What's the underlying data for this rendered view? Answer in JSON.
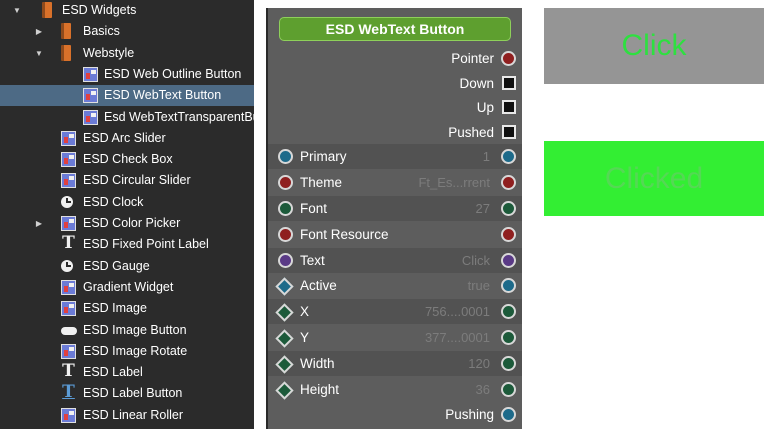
{
  "tree": {
    "items": [
      {
        "label": "ESD Widgets",
        "icon": "book-icon",
        "arrow": "expanded",
        "indent": 1,
        "selected": false
      },
      {
        "label": "Basics",
        "icon": "book-icon",
        "arrow": "collapsed",
        "indent": 2,
        "selected": false
      },
      {
        "label": "Webstyle",
        "icon": "book-icon",
        "arrow": "expanded",
        "indent": 2,
        "selected": false
      },
      {
        "label": "ESD Web Outline Button",
        "icon": "widget-icon",
        "arrow": "none",
        "indent": 3,
        "selected": false
      },
      {
        "label": "ESD WebText Button",
        "icon": "widget-icon",
        "arrow": "none",
        "indent": 3,
        "selected": true
      },
      {
        "label": "Esd WebTextTransparentBu",
        "icon": "widget-icon",
        "arrow": "none",
        "indent": 3,
        "selected": false
      },
      {
        "label": "ESD Arc Slider",
        "icon": "widget-icon",
        "arrow": "none",
        "indent": 2,
        "selected": false
      },
      {
        "label": "ESD Check Box",
        "icon": "widget-icon",
        "arrow": "none",
        "indent": 2,
        "selected": false
      },
      {
        "label": "ESD Circular Slider",
        "icon": "widget-icon",
        "arrow": "none",
        "indent": 2,
        "selected": false
      },
      {
        "label": "ESD Clock",
        "icon": "clock-icon",
        "arrow": "none",
        "indent": 2,
        "selected": false
      },
      {
        "label": "ESD Color Picker",
        "icon": "widget-icon",
        "arrow": "collapsed",
        "indent": 2,
        "selected": false
      },
      {
        "label": "ESD Fixed Point Label",
        "icon": "text-icon",
        "arrow": "none",
        "indent": 2,
        "selected": false
      },
      {
        "label": "ESD Gauge",
        "icon": "clock-icon",
        "arrow": "none",
        "indent": 2,
        "selected": false
      },
      {
        "label": "Gradient Widget",
        "icon": "widget-icon",
        "arrow": "none",
        "indent": 2,
        "selected": false
      },
      {
        "label": "ESD Image",
        "icon": "widget-icon",
        "arrow": "none",
        "indent": 2,
        "selected": false
      },
      {
        "label": "ESD Image Button",
        "icon": "image-button-icon",
        "arrow": "none",
        "indent": 2,
        "selected": false
      },
      {
        "label": "ESD Image Rotate",
        "icon": "widget-icon",
        "arrow": "none",
        "indent": 2,
        "selected": false
      },
      {
        "label": "ESD Label",
        "icon": "text-icon",
        "arrow": "none",
        "indent": 2,
        "selected": false
      },
      {
        "label": "ESD Label Button",
        "icon": "text-underline-icon",
        "arrow": "none",
        "indent": 2,
        "selected": false
      },
      {
        "label": "ESD Linear Roller",
        "icon": "widget-icon",
        "arrow": "none",
        "indent": 2,
        "selected": false
      }
    ]
  },
  "node": {
    "title": "ESD WebText Button",
    "outputs": [
      {
        "label": "Pointer",
        "port": "red"
      },
      {
        "label": "Down",
        "port": "square"
      },
      {
        "label": "Up",
        "port": "square"
      },
      {
        "label": "Pushed",
        "port": "square"
      }
    ],
    "properties": [
      {
        "label": "Primary",
        "value": "1",
        "in": "cyan",
        "out": "cyan"
      },
      {
        "label": "Theme",
        "value": "Ft_Es...rrent",
        "in": "red",
        "out": "red"
      },
      {
        "label": "Font",
        "value": "27",
        "in": "green",
        "out": "green"
      },
      {
        "label": "Font Resource",
        "value": "",
        "in": "red",
        "out": "red"
      },
      {
        "label": "Text",
        "value": "Click",
        "in": "purple",
        "out": "purple"
      },
      {
        "label": "Active",
        "value": "true",
        "in": "diamond-cyan",
        "out": "cyan"
      },
      {
        "label": "X",
        "value": "756....0001",
        "in": "diamond",
        "out": "green"
      },
      {
        "label": "Y",
        "value": "377....0001",
        "in": "diamond",
        "out": "green"
      },
      {
        "label": "Width",
        "value": "120",
        "in": "diamond",
        "out": "green"
      },
      {
        "label": "Height",
        "value": "36",
        "in": "diamond",
        "out": "green"
      }
    ],
    "footer": {
      "label": "Pushing",
      "port": "cyan"
    }
  },
  "buttons": {
    "click_label": "Click",
    "clicked_label": "Clicked"
  }
}
